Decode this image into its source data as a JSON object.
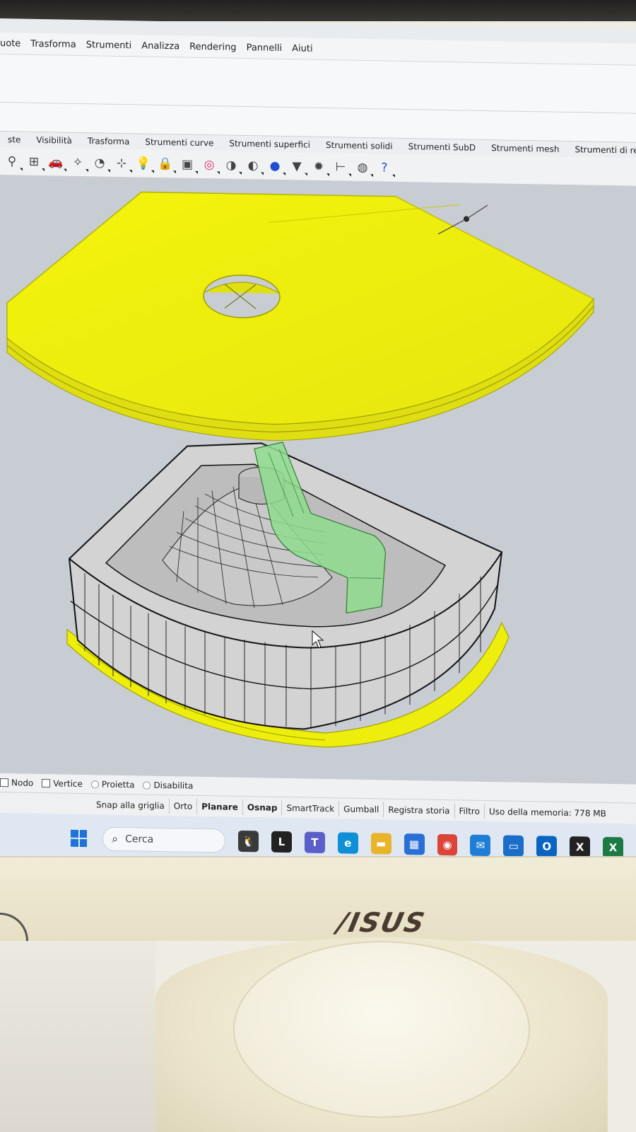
{
  "menu": {
    "items": [
      "uote",
      "Trasforma",
      "Strumenti",
      "Analizza",
      "Rendering",
      "Pannelli",
      "Aiuti"
    ]
  },
  "tabs": {
    "items": [
      "ste",
      "Visibilità",
      "Trasforma",
      "Strumenti curve",
      "Strumenti superfici",
      "Strumenti solidi",
      "Strumenti SubD",
      "Strumenti mesh",
      "Strumenti di rende"
    ]
  },
  "toolbar": {
    "icons": [
      "zoom-icon",
      "viewport-grid-icon",
      "car-icon",
      "sweep-icon",
      "rotate-view-icon",
      "snap-icon",
      "light-bulb-icon",
      "lock-icon",
      "materials-icon",
      "color-wheel-icon",
      "shaded-sphere-icon",
      "rendered-sphere-icon",
      "blue-sphere-icon",
      "funnel-icon",
      "gear-icon",
      "dimension-icon",
      "globe-icon",
      "help-icon"
    ]
  },
  "osnap": {
    "items": [
      {
        "label": "Nodo",
        "kind": "checkbox"
      },
      {
        "label": "Vertice",
        "kind": "checkbox"
      },
      {
        "label": "Proietta",
        "kind": "radio"
      },
      {
        "label": "Disabilita",
        "kind": "radio"
      }
    ]
  },
  "status": {
    "panes": [
      {
        "label": "Snap alla griglia",
        "bold": false
      },
      {
        "label": "Orto",
        "bold": false
      },
      {
        "label": "Planare",
        "bold": true
      },
      {
        "label": "Osnap",
        "bold": true
      },
      {
        "label": "SmartTrack",
        "bold": false
      },
      {
        "label": "Gumball",
        "bold": false
      },
      {
        "label": "Registra storia",
        "bold": false
      },
      {
        "label": "Filtro",
        "bold": false
      }
    ],
    "memory": "Uso della memoria: 778 MB"
  },
  "taskbar": {
    "search_placeholder": "Cerca",
    "apps": [
      {
        "name": "widget-icon",
        "glyph": "🐧",
        "color": "#3a3a3a"
      },
      {
        "name": "notes-app-icon",
        "glyph": "L",
        "color": "#222222"
      },
      {
        "name": "teams-icon",
        "glyph": "T",
        "color": "#5b5fc7"
      },
      {
        "name": "edge-icon",
        "glyph": "e",
        "color": "#0f8fd6"
      },
      {
        "name": "file-explorer-icon",
        "glyph": "▬",
        "color": "#e8b42a"
      },
      {
        "name": "store-icon",
        "glyph": "▦",
        "color": "#2a6fd6"
      },
      {
        "name": "chrome-icon",
        "glyph": "◉",
        "color": "#db4437"
      },
      {
        "name": "mail-icon",
        "glyph": "✉",
        "color": "#1f7fd8"
      },
      {
        "name": "monitor-app-icon",
        "glyph": "▭",
        "color": "#1a6dc9"
      },
      {
        "name": "outlook-icon",
        "glyph": "O",
        "color": "#0a64c2"
      },
      {
        "name": "x-app-icon",
        "glyph": "X",
        "color": "#222222"
      },
      {
        "name": "excel-icon",
        "glyph": "X",
        "color": "#1e7a44"
      }
    ]
  },
  "monitor": {
    "brand": "/ISUS"
  },
  "colors": {
    "selection_yellow": "#f2f20a",
    "gumball_green": "#7bd67b",
    "viewport_bg": "#c8ccd3"
  }
}
